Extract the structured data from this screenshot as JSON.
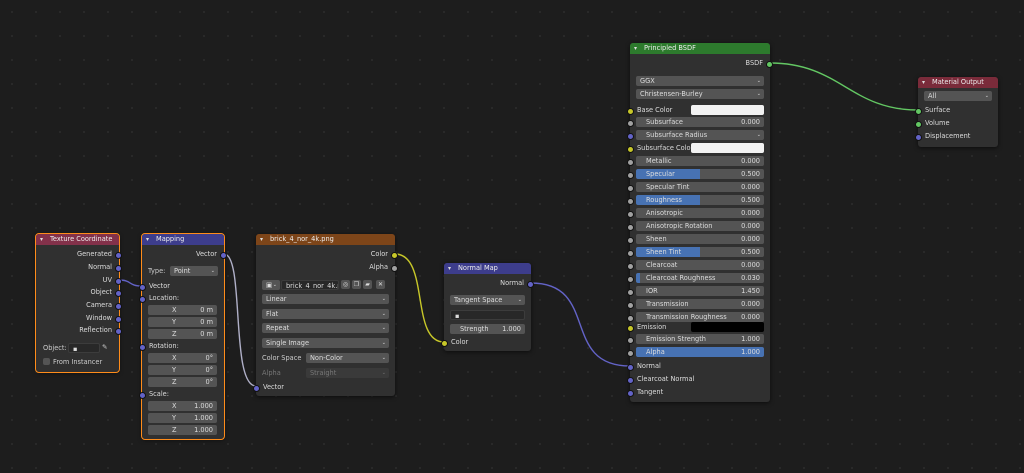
{
  "colors": {
    "texture_header": "#83314a",
    "converter_header": "#3d3d8c",
    "image_header": "#7d4519",
    "bsdf_header": "#2d7a2d",
    "output_header": "#7a2b3a",
    "link_yellow": "#c7c729",
    "link_purple": "#6363c7",
    "link_green": "#63c763",
    "link_grey": "#a1a1a1"
  },
  "texcoord": {
    "title": "Texture Coordinate",
    "outputs": [
      "Generated",
      "Normal",
      "UV",
      "Object",
      "Camera",
      "Window",
      "Reflection"
    ],
    "object_label": "Object:",
    "from_instancer": "From Instancer"
  },
  "mapping": {
    "title": "Mapping",
    "output": "Vector",
    "type_label": "Type:",
    "type_value": "Point",
    "vector_label": "Vector",
    "location_label": "Location:",
    "location": [
      {
        "axis": "X",
        "value": "0 m"
      },
      {
        "axis": "Y",
        "value": "0 m"
      },
      {
        "axis": "Z",
        "value": "0 m"
      }
    ],
    "rotation_label": "Rotation:",
    "rotation": [
      {
        "axis": "X",
        "value": "0°"
      },
      {
        "axis": "Y",
        "value": "0°"
      },
      {
        "axis": "Z",
        "value": "0°"
      }
    ],
    "scale_label": "Scale:",
    "scale": [
      {
        "axis": "X",
        "value": "1.000"
      },
      {
        "axis": "Y",
        "value": "1.000"
      },
      {
        "axis": "Z",
        "value": "1.000"
      }
    ]
  },
  "image": {
    "title": "brick_4_nor_4k.png",
    "out_color": "Color",
    "out_alpha": "Alpha",
    "filename": "brick_4_nor_4k.png",
    "interpolation": "Linear",
    "projection": "Flat",
    "extension": "Repeat",
    "source": "Single Image",
    "color_space_label": "Color Space",
    "color_space": "Non-Color",
    "alpha_label": "Alpha",
    "alpha_mode": "Straight",
    "in_vector": "Vector"
  },
  "normalmap": {
    "title": "Normal Map",
    "output": "Normal",
    "space": "Tangent Space",
    "uv_value": "",
    "strength_label": "Strength",
    "strength": "1.000",
    "in_color": "Color"
  },
  "bsdf": {
    "title": "Principled BSDF",
    "output": "BSDF",
    "distribution": "GGX",
    "subsurface_method": "Christensen-Burley",
    "base_color_label": "Base Color",
    "subsurface_color_label": "Subsurface Color",
    "emission_label": "Emission",
    "params": [
      {
        "name": "Subsurface",
        "value": "0.000",
        "fill": 0
      },
      {
        "name": "Subsurface Radius",
        "value": "",
        "fill": 0
      },
      {
        "name": "Metallic",
        "value": "0.000",
        "fill": 0
      },
      {
        "name": "Specular",
        "value": "0.500",
        "fill": 0.5
      },
      {
        "name": "Specular Tint",
        "value": "0.000",
        "fill": 0
      },
      {
        "name": "Roughness",
        "value": "0.500",
        "fill": 0.5
      },
      {
        "name": "Anisotropic",
        "value": "0.000",
        "fill": 0
      },
      {
        "name": "Anisotropic Rotation",
        "value": "0.000",
        "fill": 0
      },
      {
        "name": "Sheen",
        "value": "0.000",
        "fill": 0
      },
      {
        "name": "Sheen Tint",
        "value": "0.500",
        "fill": 0.5
      },
      {
        "name": "Clearcoat",
        "value": "0.000",
        "fill": 0
      },
      {
        "name": "Clearcoat Roughness",
        "value": "0.030",
        "fill": 0.03
      },
      {
        "name": "IOR",
        "value": "1.450",
        "fill": 0
      },
      {
        "name": "Transmission",
        "value": "0.000",
        "fill": 0
      },
      {
        "name": "Transmission Roughness",
        "value": "0.000",
        "fill": 0
      },
      {
        "name": "Emission Strength",
        "value": "1.000",
        "fill": 0
      },
      {
        "name": "Alpha",
        "value": "1.000",
        "fill": 1
      }
    ],
    "normal_label": "Normal",
    "clearcoat_normal_label": "Clearcoat Normal",
    "tangent_label": "Tangent"
  },
  "output": {
    "title": "Material Output",
    "target": "All",
    "inputs": [
      "Surface",
      "Volume",
      "Displacement"
    ]
  }
}
